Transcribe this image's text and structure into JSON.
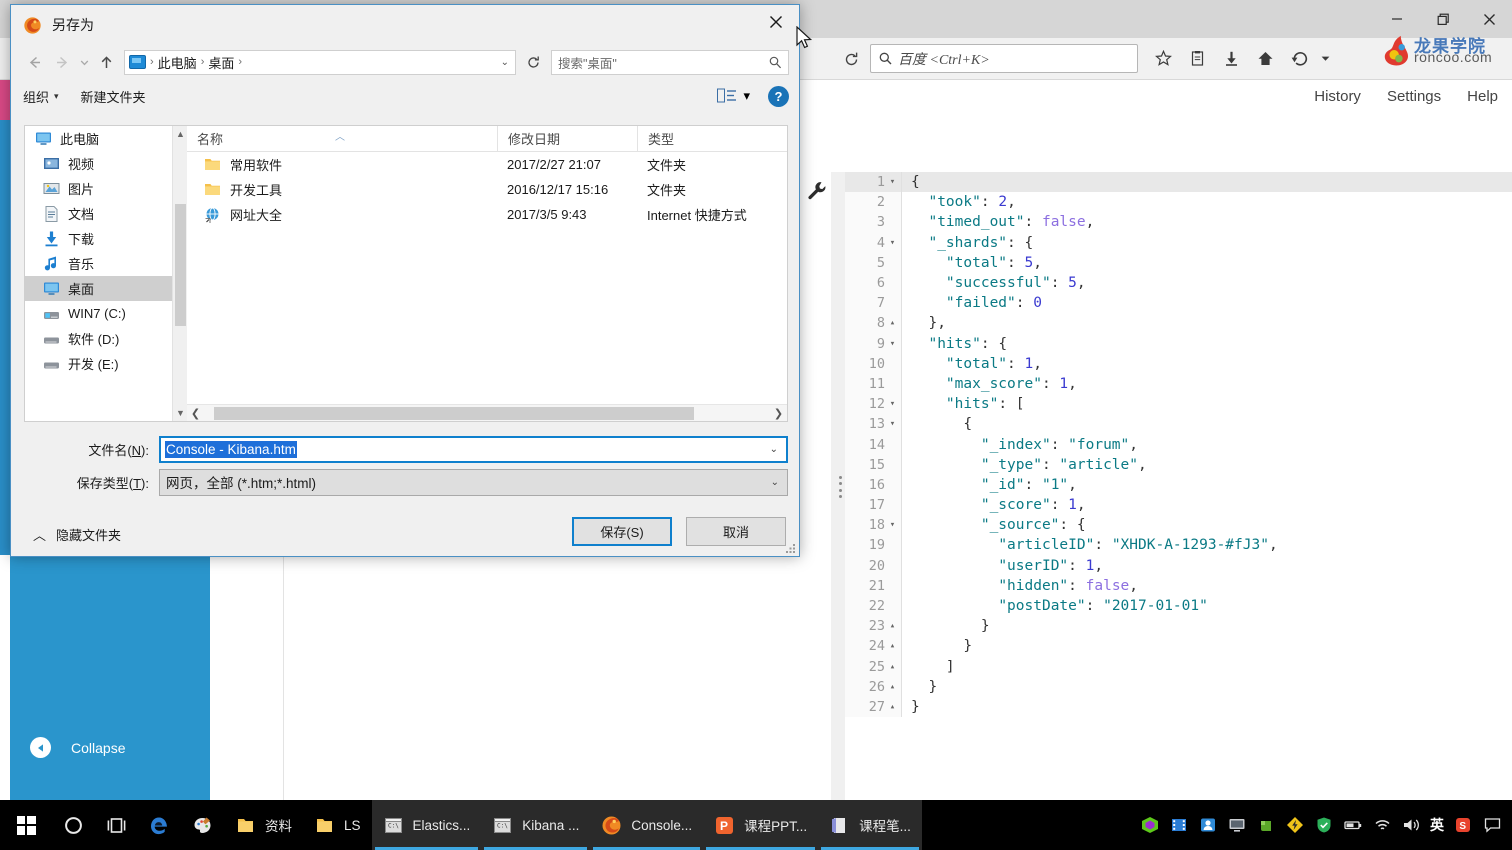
{
  "browser": {
    "search_placeholder": "百度 <Ctrl+K>",
    "logo_line1": "龙果学院",
    "logo_line2": "roncoo.com",
    "window_controls": [
      "minimize",
      "restore",
      "close"
    ],
    "toolbar_icons": [
      "bookmark-star-icon",
      "library-icon",
      "downloads-icon",
      "home-icon",
      "history-back-icon",
      "overflow-caret-icon"
    ],
    "reload_icon": "reload-icon"
  },
  "kibana": {
    "menu": [
      "History",
      "Settings",
      "Help"
    ],
    "collapse_label": "Collapse",
    "wrench_icon": "wrench-icon"
  },
  "dialog": {
    "title": "另存为",
    "close_label": "✕",
    "nav": {
      "back": "←",
      "forward": "→",
      "recent": "⌄",
      "up": "↑",
      "refresh_icon": "refresh-icon"
    },
    "breadcrumb": [
      "此电脑",
      "桌面"
    ],
    "search_placeholder": "搜索\"桌面\"",
    "toolbar": {
      "organize": "组织",
      "new_folder": "新建文件夹",
      "view_icon": "view-layout-icon",
      "help_icon": "help-icon"
    },
    "tree": [
      {
        "label": "此电脑",
        "icon": "computer-icon",
        "selected": false,
        "root": true
      },
      {
        "label": "视频",
        "icon": "videos-icon",
        "selected": false
      },
      {
        "label": "图片",
        "icon": "pictures-icon",
        "selected": false
      },
      {
        "label": "文档",
        "icon": "documents-icon",
        "selected": false
      },
      {
        "label": "下载",
        "icon": "downloads-icon",
        "selected": false
      },
      {
        "label": "音乐",
        "icon": "music-icon",
        "selected": false
      },
      {
        "label": "桌面",
        "icon": "desktop-icon",
        "selected": true
      },
      {
        "label": "WIN7 (C:)",
        "icon": "system-drive-icon",
        "selected": false
      },
      {
        "label": "软件 (D:)",
        "icon": "drive-icon",
        "selected": false
      },
      {
        "label": "开发 (E:)",
        "icon": "drive-icon",
        "selected": false
      }
    ],
    "columns": {
      "name": "名称",
      "date": "修改日期",
      "type": "类型"
    },
    "files": [
      {
        "name": "常用软件",
        "date": "2017/2/27 21:07",
        "type": "文件夹",
        "icon": "folder-icon"
      },
      {
        "name": "开发工具",
        "date": "2016/12/17 15:16",
        "type": "文件夹",
        "icon": "folder-icon"
      },
      {
        "name": "网址大全",
        "date": "2017/3/5 9:43",
        "type": "Internet 快捷方式",
        "icon": "internet-shortcut-icon"
      }
    ],
    "filename_label_a": "文件名(",
    "filename_label_key": "N",
    "filename_label_b": "):",
    "filename_value": "Console - Kibana.htm",
    "savetype_label_a": "保存类型(",
    "savetype_label_key": "T",
    "savetype_label_b": "):",
    "savetype_value": "网页，全部 (*.htm;*.html)",
    "hide_folders": "隐藏文件夹",
    "save_button": "保存(S)",
    "cancel_button": "取消"
  },
  "code": {
    "lines": [
      {
        "num": "1",
        "fold": "▾",
        "indent": 0,
        "active": true,
        "tokens": [
          [
            "p",
            "{"
          ]
        ]
      },
      {
        "num": "2",
        "fold": "",
        "indent": 1,
        "active": false,
        "tokens": [
          [
            "k",
            "\"took\""
          ],
          [
            "p",
            ": "
          ],
          [
            "n",
            "2"
          ],
          [
            "p",
            ","
          ]
        ]
      },
      {
        "num": "3",
        "fold": "",
        "indent": 1,
        "active": false,
        "tokens": [
          [
            "k",
            "\"timed_out\""
          ],
          [
            "p",
            ": "
          ],
          [
            "b",
            "false"
          ],
          [
            "p",
            ","
          ]
        ]
      },
      {
        "num": "4",
        "fold": "▾",
        "indent": 1,
        "active": false,
        "tokens": [
          [
            "k",
            "\"_shards\""
          ],
          [
            "p",
            ": {"
          ]
        ]
      },
      {
        "num": "5",
        "fold": "",
        "indent": 2,
        "active": false,
        "tokens": [
          [
            "k",
            "\"total\""
          ],
          [
            "p",
            ": "
          ],
          [
            "n",
            "5"
          ],
          [
            "p",
            ","
          ]
        ]
      },
      {
        "num": "6",
        "fold": "",
        "indent": 2,
        "active": false,
        "tokens": [
          [
            "k",
            "\"successful\""
          ],
          [
            "p",
            ": "
          ],
          [
            "n",
            "5"
          ],
          [
            "p",
            ","
          ]
        ]
      },
      {
        "num": "7",
        "fold": "",
        "indent": 2,
        "active": false,
        "tokens": [
          [
            "k",
            "\"failed\""
          ],
          [
            "p",
            ": "
          ],
          [
            "n",
            "0"
          ]
        ]
      },
      {
        "num": "8",
        "fold": "▴",
        "indent": 1,
        "active": false,
        "tokens": [
          [
            "p",
            "},"
          ]
        ]
      },
      {
        "num": "9",
        "fold": "▾",
        "indent": 1,
        "active": false,
        "tokens": [
          [
            "k",
            "\"hits\""
          ],
          [
            "p",
            ": {"
          ]
        ]
      },
      {
        "num": "10",
        "fold": "",
        "indent": 2,
        "active": false,
        "tokens": [
          [
            "k",
            "\"total\""
          ],
          [
            "p",
            ": "
          ],
          [
            "n",
            "1"
          ],
          [
            "p",
            ","
          ]
        ]
      },
      {
        "num": "11",
        "fold": "",
        "indent": 2,
        "active": false,
        "tokens": [
          [
            "k",
            "\"max_score\""
          ],
          [
            "p",
            ": "
          ],
          [
            "n",
            "1"
          ],
          [
            "p",
            ","
          ]
        ]
      },
      {
        "num": "12",
        "fold": "▾",
        "indent": 2,
        "active": false,
        "tokens": [
          [
            "k",
            "\"hits\""
          ],
          [
            "p",
            ": ["
          ]
        ]
      },
      {
        "num": "13",
        "fold": "▾",
        "indent": 3,
        "active": false,
        "tokens": [
          [
            "p",
            "{"
          ]
        ]
      },
      {
        "num": "14",
        "fold": "",
        "indent": 4,
        "active": false,
        "tokens": [
          [
            "k",
            "\"_index\""
          ],
          [
            "p",
            ": "
          ],
          [
            "s",
            "\"forum\""
          ],
          [
            "p",
            ","
          ]
        ]
      },
      {
        "num": "15",
        "fold": "",
        "indent": 4,
        "active": false,
        "tokens": [
          [
            "k",
            "\"_type\""
          ],
          [
            "p",
            ": "
          ],
          [
            "s",
            "\"article\""
          ],
          [
            "p",
            ","
          ]
        ]
      },
      {
        "num": "16",
        "fold": "",
        "indent": 4,
        "active": false,
        "tokens": [
          [
            "k",
            "\"_id\""
          ],
          [
            "p",
            ": "
          ],
          [
            "s",
            "\"1\""
          ],
          [
            "p",
            ","
          ]
        ]
      },
      {
        "num": "17",
        "fold": "",
        "indent": 4,
        "active": false,
        "tokens": [
          [
            "k",
            "\"_score\""
          ],
          [
            "p",
            ": "
          ],
          [
            "n",
            "1"
          ],
          [
            "p",
            ","
          ]
        ]
      },
      {
        "num": "18",
        "fold": "▾",
        "indent": 4,
        "active": false,
        "tokens": [
          [
            "k",
            "\"_source\""
          ],
          [
            "p",
            ": {"
          ]
        ]
      },
      {
        "num": "19",
        "fold": "",
        "indent": 5,
        "active": false,
        "tokens": [
          [
            "k",
            "\"articleID\""
          ],
          [
            "p",
            ": "
          ],
          [
            "s",
            "\"XHDK-A-1293-#fJ3\""
          ],
          [
            "p",
            ","
          ]
        ]
      },
      {
        "num": "20",
        "fold": "",
        "indent": 5,
        "active": false,
        "tokens": [
          [
            "k",
            "\"userID\""
          ],
          [
            "p",
            ": "
          ],
          [
            "n",
            "1"
          ],
          [
            "p",
            ","
          ]
        ]
      },
      {
        "num": "21",
        "fold": "",
        "indent": 5,
        "active": false,
        "tokens": [
          [
            "k",
            "\"hidden\""
          ],
          [
            "p",
            ": "
          ],
          [
            "b",
            "false"
          ],
          [
            "p",
            ","
          ]
        ]
      },
      {
        "num": "22",
        "fold": "",
        "indent": 5,
        "active": false,
        "tokens": [
          [
            "k",
            "\"postDate\""
          ],
          [
            "p",
            ": "
          ],
          [
            "s",
            "\"2017-01-01\""
          ]
        ]
      },
      {
        "num": "23",
        "fold": "▴",
        "indent": 4,
        "active": false,
        "tokens": [
          [
            "p",
            "}"
          ]
        ]
      },
      {
        "num": "24",
        "fold": "▴",
        "indent": 3,
        "active": false,
        "tokens": [
          [
            "p",
            "}"
          ]
        ]
      },
      {
        "num": "25",
        "fold": "▴",
        "indent": 2,
        "active": false,
        "tokens": [
          [
            "p",
            "]"
          ]
        ]
      },
      {
        "num": "26",
        "fold": "▴",
        "indent": 1,
        "active": false,
        "tokens": [
          [
            "p",
            "}"
          ]
        ]
      },
      {
        "num": "27",
        "fold": "▴",
        "indent": 0,
        "active": false,
        "tokens": [
          [
            "p",
            "}"
          ]
        ]
      }
    ]
  },
  "taskbar": {
    "start_icon": "windows-start-icon",
    "items": [
      {
        "label": "",
        "icon": "cortana-search-icon",
        "active": false
      },
      {
        "label": "",
        "icon": "task-view-icon",
        "active": false
      },
      {
        "label": "",
        "icon": "edge-icon",
        "active": false
      },
      {
        "label": "",
        "icon": "paint-icon",
        "active": false
      },
      {
        "label": "资料",
        "icon": "folder-icon",
        "active": false
      },
      {
        "label": "LS",
        "icon": "folder-icon",
        "active": false
      },
      {
        "label": "Elastics...",
        "icon": "console-window-icon",
        "active": true
      },
      {
        "label": "Kibana ...",
        "icon": "console-window-icon",
        "active": true
      },
      {
        "label": "Console...",
        "icon": "firefox-icon",
        "active": true
      },
      {
        "label": "课程PPT...",
        "icon": "wps-presentation-icon",
        "active": true
      },
      {
        "label": "课程笔...",
        "icon": "onenote-icon",
        "active": true
      }
    ],
    "tray": [
      "nvidia-icon",
      "film-icon",
      "contacts-icon",
      "monitor-icon",
      "evernote-icon",
      "thunder-icon",
      "shield-icon",
      "battery-icon",
      "wifi-icon",
      "volume-icon"
    ],
    "ime_label": "英",
    "sogou_icon": "sogou-icon",
    "notification_icon": "notification-icon"
  }
}
